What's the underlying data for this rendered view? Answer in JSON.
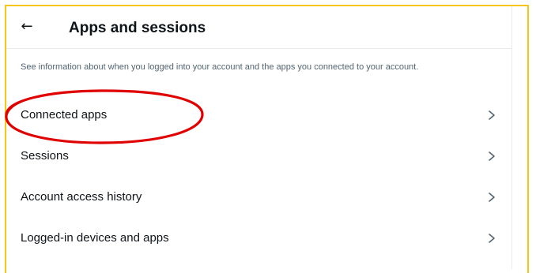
{
  "header": {
    "back_icon": "←",
    "title": "Apps and sessions"
  },
  "description": "See information about when you logged into your account and the apps you connected to your account.",
  "menu": {
    "items": [
      {
        "label": "Connected apps",
        "icon": "chevron-right-icon"
      },
      {
        "label": "Sessions",
        "icon": "chevron-right-icon"
      },
      {
        "label": "Account access history",
        "icon": "chevron-right-icon"
      },
      {
        "label": "Logged-in devices and apps",
        "icon": "chevron-right-icon"
      }
    ]
  },
  "colors": {
    "frame_border": "#f5c518",
    "annotation": "#e00000",
    "text_primary": "#0f1419",
    "text_secondary": "#536471"
  }
}
